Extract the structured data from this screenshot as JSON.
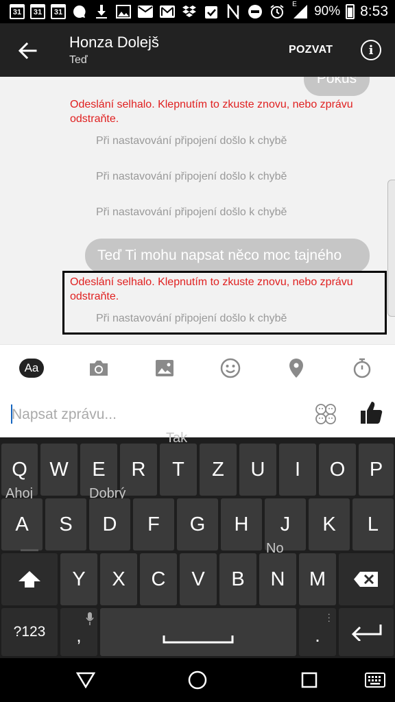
{
  "status_bar": {
    "cal_day": "31",
    "battery_text": "90%",
    "time": "8:53",
    "network_letter": "E",
    "icons": [
      "calendar-icon",
      "calendar-icon",
      "calendar-icon",
      "chat-icon",
      "download-icon",
      "image-icon",
      "mail-icon",
      "gmail-icon",
      "dropbox-icon",
      "clipboard-check-icon",
      "nfc-icon",
      "dnd-icon",
      "alarm-icon",
      "signal-icon",
      "battery-icon"
    ]
  },
  "header": {
    "title": "Honza Dolejš",
    "subtitle": "Teď",
    "invite_label": "POZVAT",
    "info_symbol": "i"
  },
  "messages": {
    "bubble_top": "Pokus",
    "error_1": "Odeslání selhalo. Klepnutím to zkuste znovu, nebo zprávu odstraňte.",
    "sub_errors": [
      "Při nastavování připojení došlo k chybě",
      "Při nastavování připojení došlo k chybě",
      "Při nastavování připojení došlo k chybě"
    ],
    "bubble_2": "Teď Ti mohu napsat něco moc tajného",
    "error_2": "Odeslání selhalo. Klepnutím to zkuste znovu, nebo zprávu odstraňte.",
    "sub_error_2": "Při nastavování připojení došlo k chybě"
  },
  "toolbar": {
    "aa_label": "Aa"
  },
  "composer": {
    "placeholder": "Napsat zprávu...",
    "value": ""
  },
  "keyboard": {
    "row1": [
      "Q",
      "W",
      "E",
      "R",
      "T",
      "Z",
      "U",
      "I",
      "O",
      "P"
    ],
    "row2": [
      "A",
      "S",
      "D",
      "F",
      "G",
      "H",
      "J",
      "K",
      "L"
    ],
    "row3": [
      "Y",
      "X",
      "C",
      "V",
      "B",
      "N",
      "M"
    ],
    "symbols_label": "?123",
    "comma": ",",
    "period": ".",
    "hints": {
      "tak": "Tak",
      "ahoj": "Ahoj",
      "dobry": "Dobrý",
      "no": "No"
    }
  },
  "colors": {
    "error_red": "#e02020",
    "bubble_gray": "#c6c6c6",
    "header_bg": "#222222",
    "keyboard_bg": "#1e1e1e"
  }
}
